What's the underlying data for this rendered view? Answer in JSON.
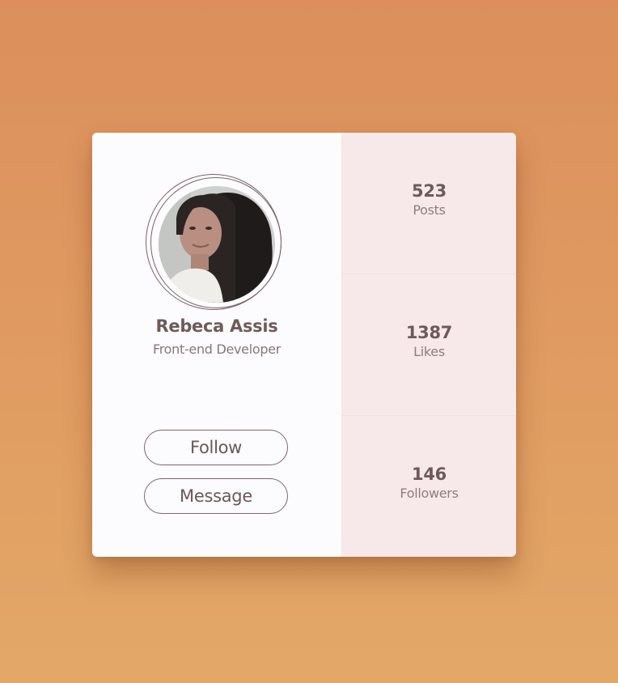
{
  "profile": {
    "name": "Rebeca Assis",
    "role": "Front-end Developer",
    "avatar_alt": "avatar-photo"
  },
  "actions": {
    "follow_label": "Follow",
    "message_label": "Message"
  },
  "stats": [
    {
      "value": "523",
      "label": "Posts"
    },
    {
      "value": "1387",
      "label": "Likes"
    },
    {
      "value": "146",
      "label": "Followers"
    }
  ],
  "colors": {
    "background_top": "#dc8f5c",
    "background_bottom": "#e3a867",
    "card": "#fcfbfd",
    "stats_panel": "#f7e9ea",
    "text_primary": "#6e5a5a",
    "text_secondary": "#8a7778"
  }
}
